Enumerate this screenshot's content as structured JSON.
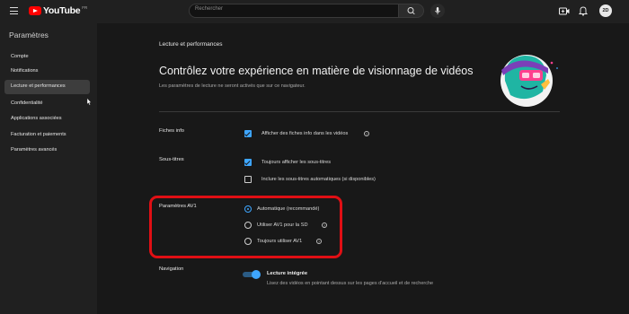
{
  "header": {
    "logo_text": "YouTube",
    "logo_region": "FR",
    "search_placeholder": "Rechercher",
    "avatar_text": "2D"
  },
  "sidebar": {
    "title": "Paramètres",
    "items": [
      {
        "label": "Compte"
      },
      {
        "label": "Notifications"
      },
      {
        "label": "Lecture et performances",
        "active": true
      },
      {
        "label": "Confidentialité"
      },
      {
        "label": "Applications associées"
      },
      {
        "label": "Facturation et paiements"
      },
      {
        "label": "Paramètres avancés"
      }
    ]
  },
  "main": {
    "section_title": "Lecture et performances",
    "headline": "Contrôlez votre expérience en matière de visionnage de vidéos",
    "subline": "Les paramètres de lecture ne seront activés que sur ce navigateur.",
    "info_cards": {
      "label": "Fiches info",
      "option": "Afficher des fiches info dans les vidéos",
      "checked": true
    },
    "subtitles": {
      "label": "Sous-titres",
      "options": [
        {
          "text": "Toujours afficher les sous-titres",
          "checked": true
        },
        {
          "text": "Inclure les sous-titres automatiques (si disponibles)",
          "checked": false
        }
      ]
    },
    "av1": {
      "label": "Paramètres AV1",
      "options": [
        {
          "text": "Automatique (recommandé)",
          "selected": true
        },
        {
          "text": "Utiliser AV1 pour la SD",
          "selected": false
        },
        {
          "text": "Toujours utiliser AV1",
          "selected": false
        }
      ]
    },
    "navigation": {
      "label": "Navigation",
      "toggle_title": "Lecture intégrée",
      "toggle_description": "Lisez des vidéos en pointant dessus sur les pages d'accueil et de recherche",
      "enabled": true
    }
  },
  "colors": {
    "accent": "#3ea6ff",
    "highlight": "#e00f14",
    "brand": "#ff0000"
  }
}
